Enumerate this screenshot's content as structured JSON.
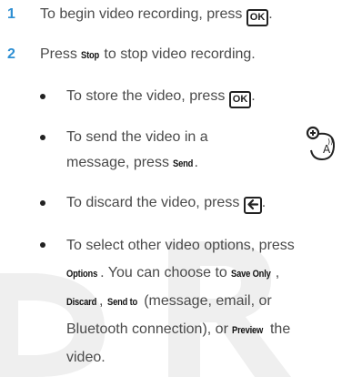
{
  "watermark_text": "DRAFT",
  "icons": {
    "ok_button": "ok-key",
    "back_button": "back-arrow-key",
    "side_icon": "message-feature-icon"
  },
  "colors": {
    "step_number": "#2e8fd3",
    "body_text": "#4a4a4a",
    "watermark": "#ececec"
  },
  "steps": [
    {
      "number": "1",
      "text_before": "To begin video recording, press ",
      "button": "OK",
      "text_after": "."
    },
    {
      "number": "2",
      "text_before": "Press ",
      "key": "Stop",
      "text_after": " to stop video recording."
    }
  ],
  "bullets": {
    "store": {
      "before": "To store the video, press ",
      "button": "OK",
      "after": "."
    },
    "send": {
      "line1": "To send the video in a",
      "line2_before": "message, press ",
      "key": "Send",
      "line2_after": "."
    },
    "discard": {
      "before": "To discard the video, press ",
      "after": "."
    },
    "options": {
      "line1": "To select other video options, press",
      "options_key": "Options",
      "after_options": ". You can choose to ",
      "save_only": "Save Only",
      "comma1": ",",
      "discard_key": "Discard",
      "comma2": ", ",
      "send_to": "Send to",
      "after_send_to": " (message, email, or",
      "line4": "Bluetooth connection), or ",
      "preview": "Preview",
      "after_preview": " the",
      "line5": "video."
    }
  }
}
